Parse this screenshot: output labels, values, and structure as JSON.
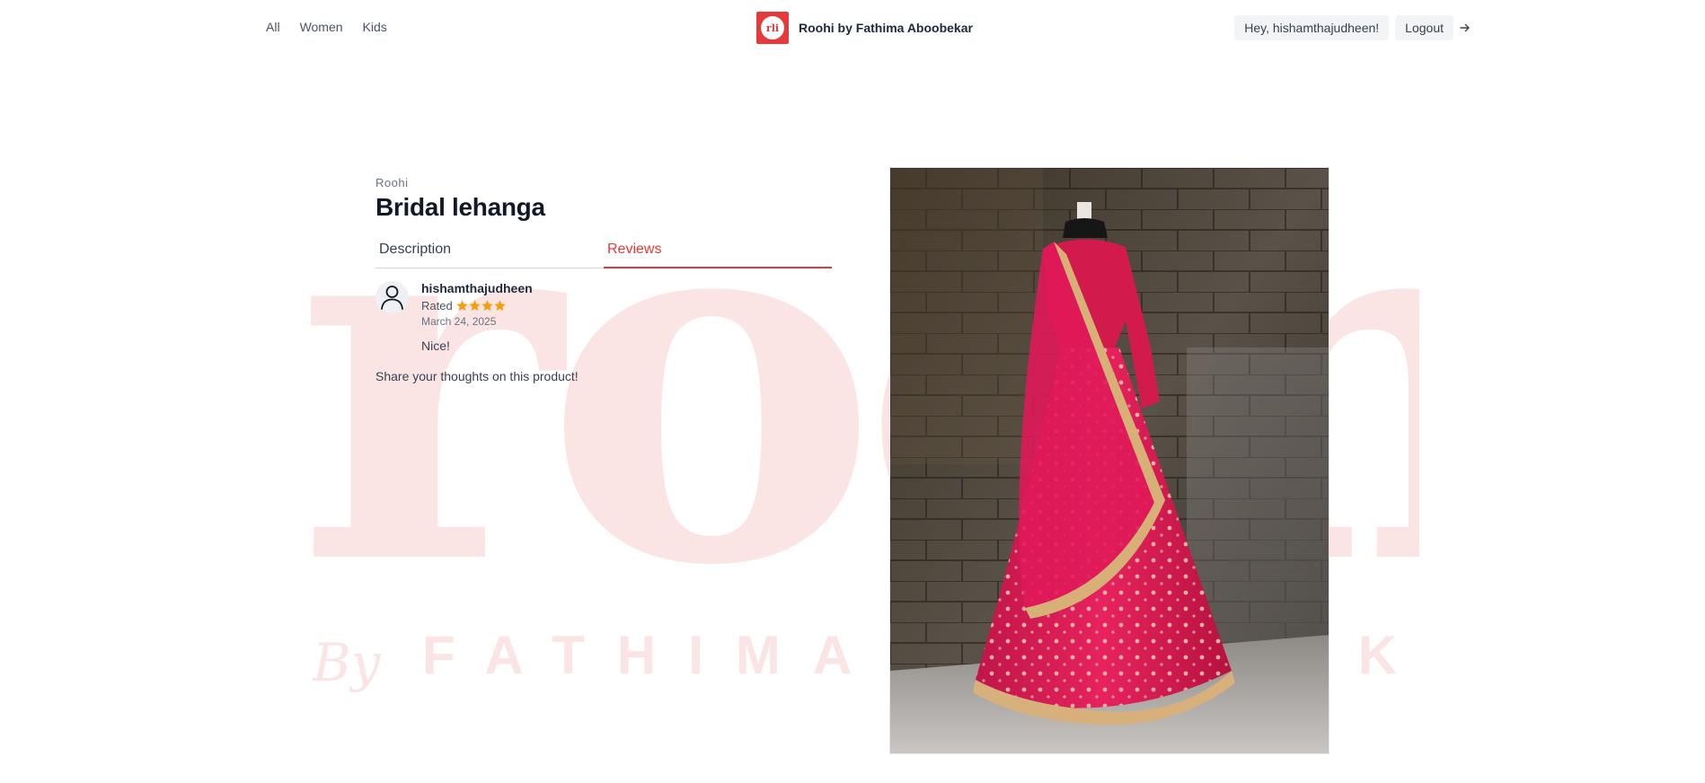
{
  "nav": {
    "links": [
      "All",
      "Women",
      "Kids"
    ]
  },
  "brand": {
    "logo_text": "rli",
    "name": "Roohi by Fathima Aboobekar"
  },
  "user": {
    "greeting": "Hey, hishamthajudheen!",
    "logout_label": "Logout"
  },
  "product": {
    "brand": "Roohi",
    "title": "Bridal lehanga",
    "image_alt": "Bridal lehanga"
  },
  "tabs": [
    {
      "label": "Description",
      "active": false
    },
    {
      "label": "Reviews",
      "active": true
    }
  ],
  "reviews": [
    {
      "author": "hishamthajudheen",
      "rated_label": "Rated",
      "rating": 4,
      "date": "March 24, 2025",
      "text": "Nice!"
    }
  ],
  "share_prompt": "Share your thoughts on this product!",
  "colors": {
    "accent": "#e53935",
    "star": "#f59e0b",
    "watermark": "#fbe6e6"
  },
  "watermark_logo": {
    "wordmark": "roohi",
    "tagline": "By FATHIMA ABOOBEKAR"
  }
}
